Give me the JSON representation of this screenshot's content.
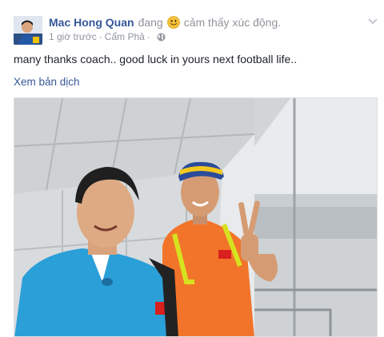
{
  "post": {
    "author": "Mac Hong Quan",
    "status_prefix": "đang",
    "feeling_icon": "smiley-face-icon",
    "feeling": "cảm thấy xúc động.",
    "time": "1 giờ trước",
    "separator": "·",
    "location": "Cẩm Phả",
    "separator2": "·",
    "privacy_icon": "globe-icon",
    "text": "many thanks coach.. good luck in yours next football life..",
    "translate_label": "Xem bản dịch",
    "photo_icon": "photo-two-men-at-airport"
  },
  "colors": {
    "link": "#365899",
    "meta": "#90949c",
    "text": "#1d2129"
  }
}
